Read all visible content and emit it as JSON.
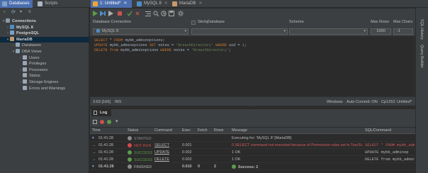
{
  "window_tabs": [
    {
      "label": "Databases",
      "active": true
    },
    {
      "label": "Scripts",
      "active": false
    },
    {
      "label": "1: Untitled*",
      "active": true
    },
    {
      "label": "MySQL 8",
      "active": false
    },
    {
      "label": "MariaDB",
      "active": false
    }
  ],
  "sidebar": {
    "items": [
      {
        "label": "Connections",
        "level": 0,
        "bold": true,
        "arrow": "▾",
        "icon_color": "#8a9ba8"
      },
      {
        "label": "MySQL 8",
        "level": 1,
        "bold": true,
        "arrow": "›",
        "icon_color": "#4e8dc6"
      },
      {
        "label": "PostgreSQL",
        "level": 1,
        "bold": true,
        "arrow": "›",
        "icon_color": "#7a9fc8"
      },
      {
        "label": "MariaDB",
        "level": 1,
        "bold": true,
        "arrow": "▾",
        "icon_color": "#c49a6c",
        "selected": true
      },
      {
        "label": "Databases",
        "level": 2,
        "bold": false,
        "arrow": "›",
        "icon_color": "#8fa5b8"
      },
      {
        "label": "DBA Views",
        "level": 2,
        "bold": false,
        "arrow": "▾",
        "icon_color": "#8fa5b8"
      },
      {
        "label": "Users",
        "level": 3,
        "bold": false,
        "arrow": "›",
        "icon_color": "#9aa7b5"
      },
      {
        "label": "Privileges",
        "level": 3,
        "bold": false,
        "arrow": "",
        "icon_color": "#9aa7b5"
      },
      {
        "label": "Processes",
        "level": 3,
        "bold": false,
        "arrow": "›",
        "icon_color": "#9aa7b5"
      },
      {
        "label": "Status",
        "level": 3,
        "bold": false,
        "arrow": "",
        "icon_color": "#9aa7b5"
      },
      {
        "label": "Storage Engines",
        "level": 3,
        "bold": false,
        "arrow": "›",
        "icon_color": "#9aa7b5"
      },
      {
        "label": "Errors and Warnings",
        "level": 3,
        "bold": false,
        "arrow": "",
        "icon_color": "#9aa7b5"
      }
    ]
  },
  "connection_bar": {
    "database_connection_label": "Database Connection",
    "database_connection_value": "MySQL 8",
    "sticky_label": "Sticky",
    "database_label": "Database",
    "database_value": "",
    "schema_label": "Schema",
    "schema_value": "",
    "max_rows_label": "Max Rows",
    "max_rows_value": "1000",
    "max_chars_label": "Max Chars",
    "max_chars_value": "-1"
  },
  "editor": {
    "lines": [
      [
        {
          "t": "SELECT",
          "c": "kw"
        },
        {
          "t": " * ",
          "c": "id"
        },
        {
          "t": "FROM",
          "c": "kw"
        },
        {
          "t": " mybb_adminoptions;",
          "c": "id"
        }
      ],
      [
        {
          "t": "UPDATE",
          "c": "kw"
        },
        {
          "t": " mybb_adminoptions ",
          "c": "id"
        },
        {
          "t": "SET",
          "c": "kw"
        },
        {
          "t": " notes = ",
          "c": "id"
        },
        {
          "t": "'BreachDirectory'",
          "c": "str"
        },
        {
          "t": " ",
          "c": "id"
        },
        {
          "t": "WHERE",
          "c": "kw"
        },
        {
          "t": " uid = ",
          "c": "id"
        },
        {
          "t": "1",
          "c": "num"
        },
        {
          "t": ";",
          "c": "id"
        }
      ],
      [
        {
          "t": "DELETE",
          "c": "kw"
        },
        {
          "t": " ",
          "c": "id"
        },
        {
          "t": "from",
          "c": "kw"
        },
        {
          "t": " mybb_adminoptions ",
          "c": "id"
        },
        {
          "t": "WHERE",
          "c": "kw"
        },
        {
          "t": " notes = ",
          "c": "id"
        },
        {
          "t": "'BreachDirectory'",
          "c": "str"
        },
        {
          "t": ";",
          "c": "id"
        }
      ]
    ],
    "status": {
      "position": "3:63 [166]",
      "mode": "INS",
      "line_sep": "Windows",
      "auto_commit": "Auto Commit: ON",
      "encoding": "Cp1252",
      "file_state": "Untitled*"
    }
  },
  "right_stripe": {
    "sql_history": "SQL History",
    "query_builder": "Query Builder"
  },
  "log": {
    "tab_label": "Log",
    "columns": [
      "Time",
      "Status",
      "Command",
      "Exec",
      "Fetch",
      "Rows",
      "Message",
      "SQL/Command"
    ],
    "rows": [
      {
        "time": "01:41:28",
        "status": "STARTED",
        "status_color": "#8c8c8c",
        "command": "",
        "exec": "",
        "fetch": "",
        "rows": "",
        "message": "Executing for: 'MySQL 8' [MariaDB]",
        "message_color": "#bbbbbb",
        "sql": "",
        "bold": false,
        "parent": true
      },
      {
        "time": "01:41:28",
        "status": "NOT RUN",
        "status_color": "#d64a4a",
        "command": "SELECT",
        "exec": "0.001",
        "fetch": "",
        "rows": "",
        "message": "0 SELECT command not executed because of Permission rules set in Tool Er...",
        "message_color": "#d65c5c",
        "sql": "SELECT * FROM mybb_adm",
        "sql_color": "#d65c5c",
        "bold": false,
        "parent": false
      },
      {
        "time": "01:41:28",
        "status": "SUCCESS",
        "status_color": "#5d9b4a",
        "command": "UPDATE",
        "exec": "0.002",
        "fetch": "",
        "rows": "",
        "message": "1 OK",
        "message_color": "#bbbbbb",
        "sql": "UPDATE mybb_adminop",
        "sql_color": "#bbbbbb",
        "bold": false,
        "parent": false
      },
      {
        "time": "01:41:28",
        "status": "SUCCESS",
        "status_color": "#5d9b4a",
        "command": "DELETE",
        "exec": "0.002",
        "fetch": "",
        "rows": "",
        "message": "1 OK",
        "message_color": "#bbbbbb",
        "sql": "DELETE from mybb_admin",
        "sql_color": "#bbbbbb",
        "bold": false,
        "parent": false
      },
      {
        "time": "01:41:28",
        "status": "FINISHED",
        "status_color": "#8c8c8c",
        "command": "",
        "exec": "0.010",
        "fetch": "0",
        "rows": "2",
        "message": "Success: 2",
        "message_color": "#bbbbbb",
        "sql": "",
        "bold": true,
        "parent": true
      }
    ]
  },
  "colors": {
    "accent": "#4b6eaf",
    "selection": "#0d293e",
    "success": "#5d9b4a",
    "error": "#d64a4a"
  }
}
